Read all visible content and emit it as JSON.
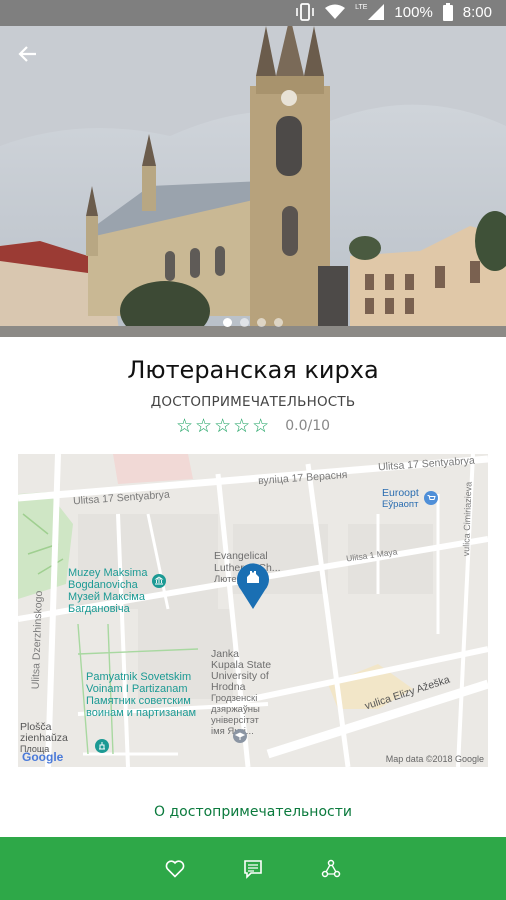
{
  "status_bar": {
    "network": "LTE",
    "battery": "100%",
    "time": "8:00"
  },
  "carousel": {
    "total": 4,
    "active": 1
  },
  "place": {
    "title": "Лютеранская кирха",
    "category": "ДОСТОПРИМЕЧАТЕЛЬНОСТЬ",
    "rating_stars": 5,
    "rating_value": 0,
    "score": "0.0/10"
  },
  "map": {
    "streets": {
      "top_latin": "Ulitsa 17 Sentyabrya",
      "top_cyrillic": "вуліца 17 Верасня",
      "top_right_latin": "Ulitsa 17 Sentyabrya",
      "dzerzhinskogo": "Ulitsa Dzerzhinskogo",
      "maya": "Ulitsa 1 Maya",
      "cimiriazieva": "vulica Cimiriazieva",
      "azheshka": "vulica Elizy Ažeška"
    },
    "pois": {
      "euroopt_latin": "Euroopt",
      "euroopt_cyr": "Еўраопт",
      "muzey_latin_1": "Muzey Maksima",
      "muzey_latin_2": "Bogdanovicha",
      "muzey_cyr_1": "Музей Максіма",
      "muzey_cyr_2": "Багдановіча",
      "church_latin_1": "Evangelical",
      "church_latin_2": "Lutheran Ch...",
      "church_cyr": "Лютеранск...",
      "univ_1": "Janka",
      "univ_2": "Kupala State",
      "univ_3": "University of",
      "univ_4": "Hrodna",
      "univ_cyr_1": "Гродзенскі",
      "univ_cyr_2": "дзяржаўны",
      "univ_cyr_3": "універсітэт",
      "univ_cyr_4": "імя Янкі...",
      "pamyat_1": "Pamyatnik Sovetskim",
      "pamyat_2": "Voinam I Partizanam",
      "pamyat_cyr_1": "Памятник советским",
      "pamyat_cyr_2": "воинам и партизанам",
      "plosca_1": "Plošča",
      "plosca_2": "zienhaŭza",
      "plosca_3": "Площа"
    },
    "google": "Google",
    "attribution": "Map data ©2018 Google"
  },
  "about_link": "О достопримечательности",
  "icons": {
    "back": "arrow-back-icon",
    "favorite": "heart-icon",
    "reviews": "comment-icon",
    "share": "share-icon"
  },
  "colors": {
    "accent": "#2ea848",
    "link": "#0b7a3d",
    "star": "#1aa160",
    "marker": "#1a6fb3"
  }
}
